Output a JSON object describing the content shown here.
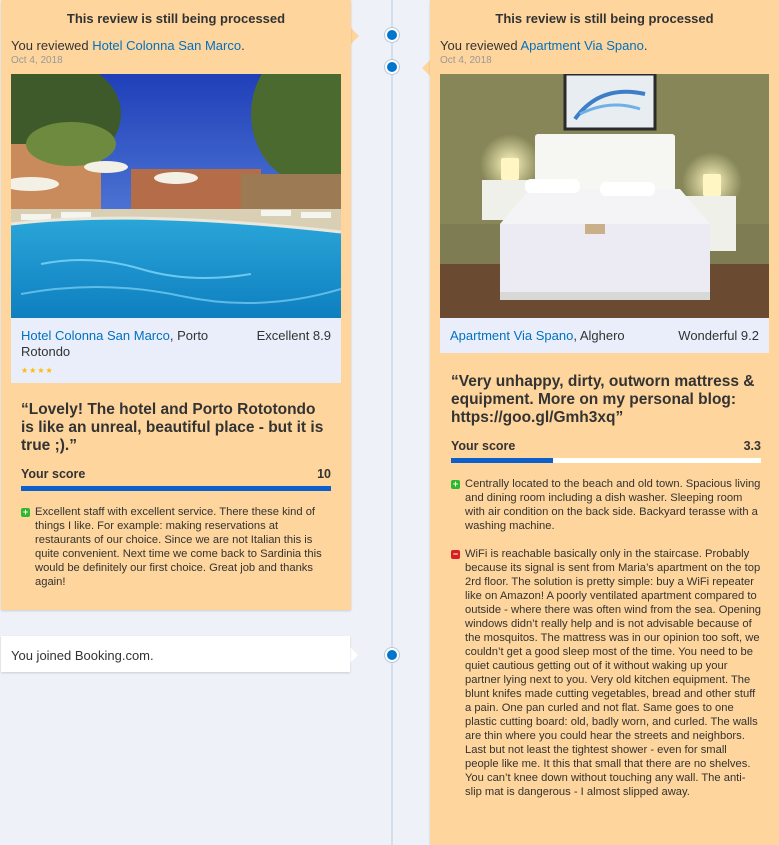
{
  "timeline": {
    "left_review": {
      "status_title": "This review is still being processed",
      "reviewed_prefix": "You reviewed",
      "property_link": "Hotel Colonna San Marco",
      "period": ".",
      "date": "Oct 4, 2018",
      "property_name": "Hotel Colonna San Marco",
      "location": ", Porto Rotondo",
      "rating_word_score": "Excellent 8.9",
      "stars": "★★★★",
      "quote": "“Lovely! The hotel and Porto Rototondo is like an unreal, beautiful place - but it is true ;).”",
      "your_score_label": "Your score",
      "your_score_value": "10",
      "your_score_fraction": 1.0,
      "positive": "Excellent staff with excellent service. There these kind of things I like. For example: making reservations at restaurants of our choice. Since we are not Italian this is quite convenient. Next time we come back to Sardinia this would be definitely our first choice. Great job and thanks again!"
    },
    "right_review": {
      "status_title": "This review is still being processed",
      "reviewed_prefix": "You reviewed",
      "property_link": "Apartment Via Spano",
      "period": ".",
      "date": "Oct 4, 2018",
      "property_name": "Apartment Via Spano",
      "location": ", Alghero",
      "rating_word_score": "Wonderful 9.2",
      "quote": "“Very unhappy, dirty, outworn mattress & equipment. More on my personal blog: https://goo.gl/Gmh3xq”",
      "your_score_label": "Your score",
      "your_score_value": "3.3",
      "your_score_fraction": 0.33,
      "positive": "Centrally located to the beach and old town. Spacious living and dining room including a dish washer. Sleeping room with air condition on the back side. Backyard terasse with a washing machine.",
      "negative": "WiFi is reachable basically only in the staircase. Probably because its signal is sent from Maria’s apartment on the top 2rd floor. The solution is pretty simple: buy a WiFi repeater like on Amazon! A poorly ventilated apartment compared to outside - where there was often wind from the sea. Opening windows didn’t really help and is not advisable because of the mosquitos. The mattress was in our opinion too soft, we couldn’t get a good sleep most of the time. You need to be quiet cautious getting out of it without waking up your partner lying next to you. Very old kitchen equipment. The blunt knifes made cutting vegetables, bread and other stuff a pain. One pan curled and not flat. Same goes to one plastic cutting board: old, badly worn, and curled. The walls are thin where you could hear the streets and neighbors. Last but not least the tightest shower - even for small people like me. It this that small that there are no shelves. You can’t knee down without touching any wall. The anti-slip mat is dangerous - I almost slipped away."
    },
    "joined": {
      "text": "You joined Booking.com."
    }
  },
  "colors": {
    "card_bg": "#fed59c",
    "link": "#0071c2",
    "timeline_dot": "#0077cc",
    "score_bar": "#0d5fcc",
    "plus_icon": "#2eb82e",
    "minus_icon": "#d81e1e"
  },
  "icons": {
    "plus": "plus-icon",
    "minus": "minus-icon",
    "timeline_dot": "timeline-dot-icon"
  }
}
